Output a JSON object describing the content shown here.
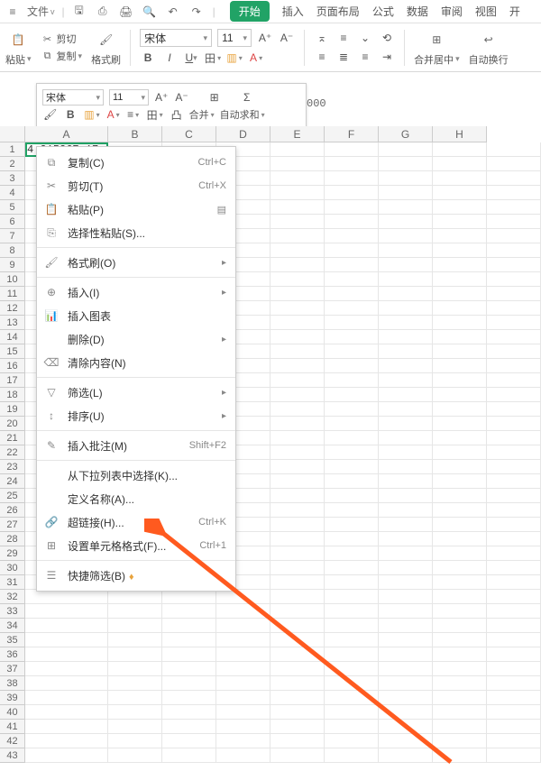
{
  "menubar": {
    "file": "文件"
  },
  "tabs": {
    "start": "开始",
    "insert": "插入",
    "layout": "页面布局",
    "formula": "公式",
    "data": "数据",
    "review": "审阅",
    "view": "视图",
    "dev": "开"
  },
  "ribbon": {
    "paste": "粘贴",
    "cut": "剪切",
    "copy": "复制",
    "format_painter": "格式刷",
    "font_name": "宋体",
    "font_size": "11",
    "merge_center": "合并居中",
    "auto_wrap": "自动换行"
  },
  "float_tb": {
    "font_name": "宋体",
    "font_size": "11",
    "merge": "合并",
    "autosum": "自动求和"
  },
  "formula_bar_text": "000",
  "columns": [
    "A",
    "B",
    "C",
    "D",
    "E",
    "F",
    "G",
    "H"
  ],
  "cell_a1": "4.21526E+17",
  "ctx": {
    "copy": "复制(C)",
    "copy_sc": "Ctrl+C",
    "cut": "剪切(T)",
    "cut_sc": "Ctrl+X",
    "paste": "粘贴(P)",
    "paste_special": "选择性粘贴(S)...",
    "format_painter": "格式刷(O)",
    "insert": "插入(I)",
    "insert_chart": "插入图表",
    "delete": "删除(D)",
    "clear": "清除内容(N)",
    "filter": "筛选(L)",
    "sort": "排序(U)",
    "comment": "插入批注(M)",
    "comment_sc": "Shift+F2",
    "dropdown": "从下拉列表中选择(K)...",
    "define_name": "定义名称(A)...",
    "hyperlink": "超链接(H)...",
    "hyperlink_sc": "Ctrl+K",
    "format_cells": "设置单元格格式(F)...",
    "format_cells_sc": "Ctrl+1",
    "quick_filter": "快捷筛选(B)"
  }
}
